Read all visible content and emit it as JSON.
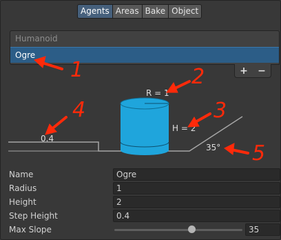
{
  "tabs": [
    {
      "label": "Agents",
      "active": true
    },
    {
      "label": "Areas",
      "active": false
    },
    {
      "label": "Bake",
      "active": false
    },
    {
      "label": "Object",
      "active": false
    }
  ],
  "agent_list": {
    "items": [
      {
        "label": "Humanoid",
        "selected": false
      },
      {
        "label": "Ogre",
        "selected": true
      }
    ],
    "add_label": "+",
    "remove_label": "−"
  },
  "diagram": {
    "radius_label": "R = 1",
    "height_label": "H = 2",
    "step_label": "0.4",
    "slope_label": "35°",
    "agent_color": "#1fa5dc"
  },
  "annotations": [
    "1",
    "2",
    "3",
    "4",
    "5"
  ],
  "annotation_color": "#ff2a0a",
  "properties": [
    {
      "label": "Name",
      "value": "Ogre"
    },
    {
      "label": "Radius",
      "value": "1"
    },
    {
      "label": "Height",
      "value": "2"
    },
    {
      "label": "Step Height",
      "value": "0.4"
    },
    {
      "label": "Max Slope",
      "value": "35",
      "slider_fraction": 0.6
    }
  ]
}
